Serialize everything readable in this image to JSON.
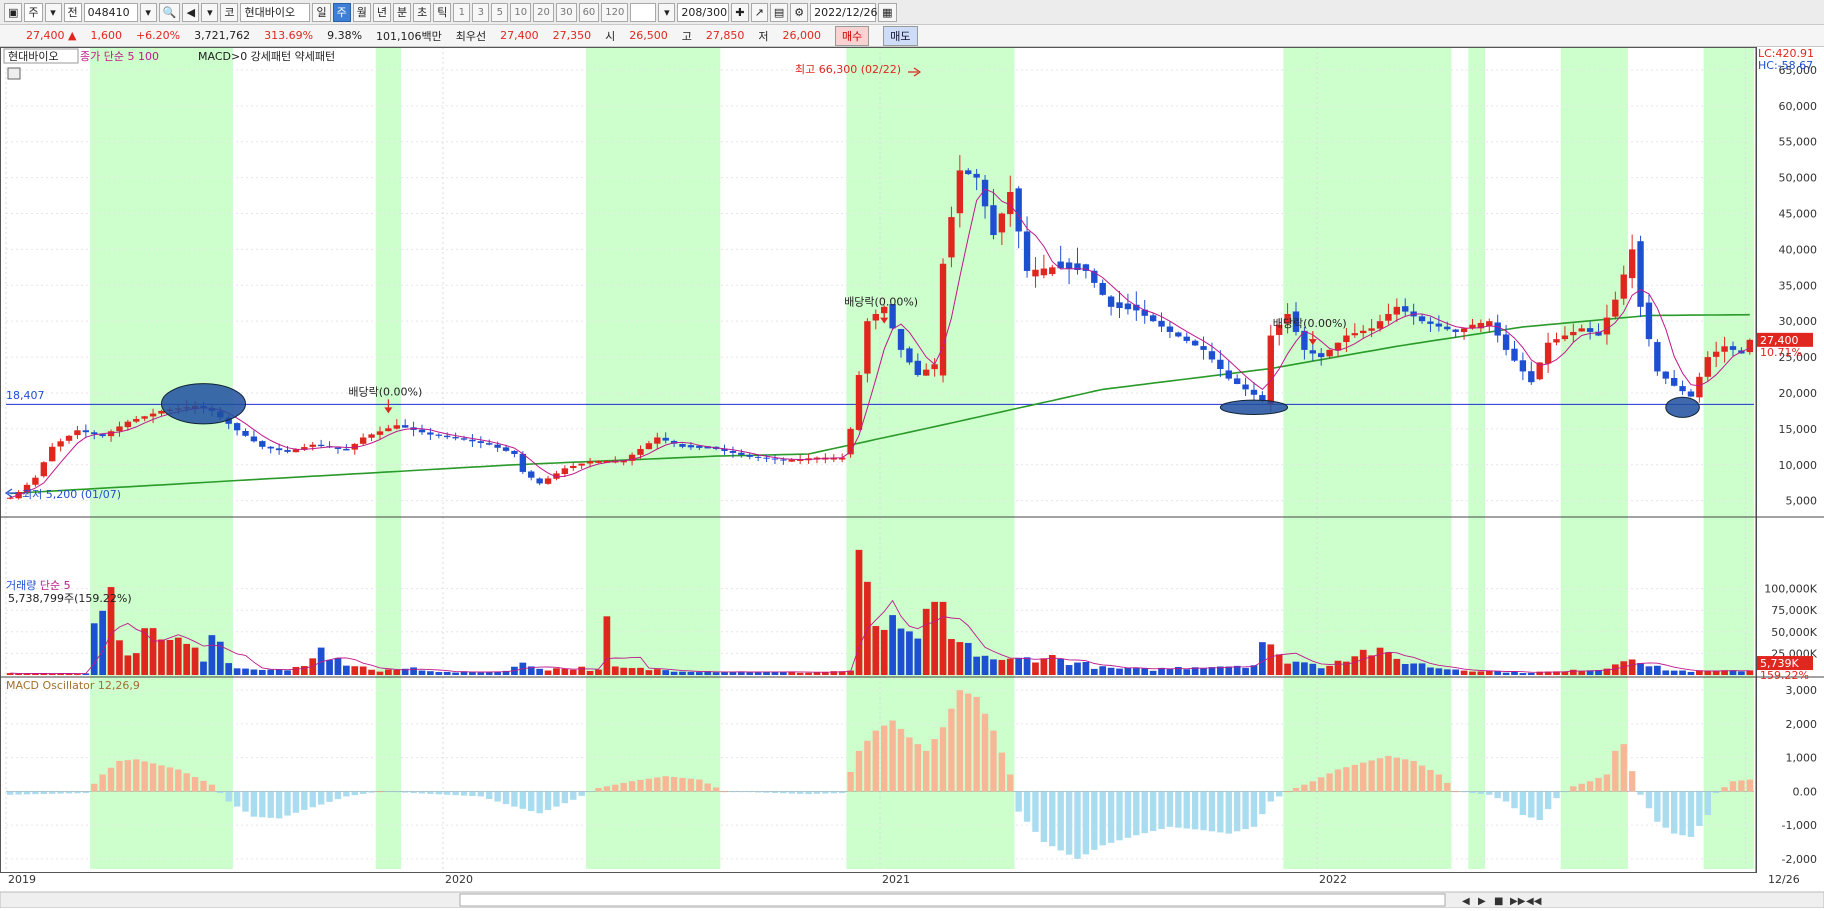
{
  "toolbar": {
    "type_label": "주",
    "market_label": "전",
    "code": "048410",
    "market2": "코",
    "name": "현대바이오",
    "periods": [
      "일",
      "주",
      "월",
      "년"
    ],
    "active_period": "주",
    "min_labels": [
      "분",
      "초",
      "틱"
    ],
    "numbers": [
      "1",
      "3",
      "5",
      "10",
      "20",
      "30",
      "60",
      "120"
    ],
    "count": "208/300",
    "date": "2022/12/26"
  },
  "quote": {
    "price": "27,400",
    "arrow": "▲",
    "change": "1,600",
    "change_pct": "+6.20%",
    "volume": "3,721,762",
    "volume_pct": "313.69%",
    "turnover": "9.38%",
    "market_cap": "101,106백만",
    "best_label": "최우선",
    "ask": "27,400",
    "bid": "27,350",
    "open_label": "시",
    "open": "26,500",
    "high_label": "고",
    "high": "27,850",
    "low_label": "저",
    "low": "26,000",
    "buy_label": "매수",
    "sell_label": "매도"
  },
  "price_panel": {
    "legend_name": "현대바이오",
    "legend_ma": "종가 단순 5 100",
    "legend_pattern": "MACD>0 강세패턴 약세패턴",
    "lc": "LC:420.91",
    "hc": "HC:-58.67",
    "ref_line_value": "18,407",
    "current_price": "27,400",
    "current_pct": "10.71%",
    "high_annotation": "최고 66,300 (02/22)",
    "low_annotation": "최저 5,200 (01/07)",
    "dividend_label": "배당락(0.00%)"
  },
  "volume_panel": {
    "legend": "거래량",
    "legend_ma": "단순 5",
    "value_text": "5,738,799주(159.22%)",
    "current": "5,739K",
    "current_pct": "159.22%"
  },
  "macd_panel": {
    "legend": "MACD Oscillator 12,26,9"
  },
  "colors": {
    "up": "#e0271f",
    "down": "#1f4fd1",
    "ma5": "#c0188c",
    "ma100": "#2a9a2a",
    "band": "#ccffcc",
    "macd_pos": "#f7b797",
    "macd_neg": "#a9dcef"
  },
  "chart_data": {
    "type": "candlestick",
    "price_axis": {
      "ticks": [
        "65,000",
        "60,000",
        "55,000",
        "50,000",
        "45,000",
        "40,000",
        "35,000",
        "30,000",
        "25,000",
        "20,000",
        "15,000",
        "10,000",
        "5,000"
      ],
      "range": [
        3000,
        67500
      ]
    },
    "volume_axis": {
      "ticks": [
        "100,000K",
        "75,000K",
        "50,000K",
        "25,000K"
      ],
      "range": [
        0,
        125000
      ]
    },
    "macd_axis": {
      "ticks": [
        "3,000",
        "2,000",
        "1,000",
        "0.00",
        "-1,000",
        "-2,000"
      ],
      "range": [
        -2300,
        3300
      ]
    },
    "x_labels": [
      {
        "label": "2019",
        "week": 0
      },
      {
        "label": "2020",
        "week": 52
      },
      {
        "label": "2021",
        "week": 104
      },
      {
        "label": "2022",
        "week": 156
      },
      {
        "label": "12/26",
        "week": 207
      }
    ],
    "weeks": 208,
    "highlight_bands": [
      [
        10,
        26
      ],
      [
        44,
        46
      ],
      [
        69,
        84
      ],
      [
        100,
        119
      ],
      [
        152,
        171
      ],
      [
        174,
        175
      ],
      [
        185,
        192
      ],
      [
        202,
        207
      ]
    ],
    "ref_price": 18407,
    "price_key_points": [
      [
        0,
        5400
      ],
      [
        1,
        6200
      ],
      [
        2,
        7200
      ],
      [
        3,
        8200
      ],
      [
        5,
        12500
      ],
      [
        8,
        14800
      ],
      [
        11,
        14000
      ],
      [
        14,
        16000
      ],
      [
        18,
        17500
      ],
      [
        22,
        18200
      ],
      [
        24,
        17500
      ],
      [
        27,
        14800
      ],
      [
        30,
        12500
      ],
      [
        33,
        11800
      ],
      [
        36,
        12800
      ],
      [
        40,
        12000
      ],
      [
        42,
        13800
      ],
      [
        46,
        15500
      ],
      [
        50,
        14200
      ],
      [
        54,
        13500
      ],
      [
        57,
        12800
      ],
      [
        60,
        11500
      ],
      [
        61,
        9000
      ],
      [
        63,
        7400
      ],
      [
        66,
        9500
      ],
      [
        69,
        10500
      ],
      [
        73,
        10600
      ],
      [
        77,
        13800
      ],
      [
        80,
        12500
      ],
      [
        84,
        12200
      ],
      [
        88,
        11100
      ],
      [
        92,
        10600
      ],
      [
        96,
        11000
      ],
      [
        99,
        11000
      ],
      [
        100,
        15000
      ],
      [
        102,
        30000
      ],
      [
        104,
        32000
      ],
      [
        106,
        26000
      ],
      [
        108,
        22500
      ],
      [
        110,
        24000
      ],
      [
        111,
        38000
      ],
      [
        113,
        51000
      ],
      [
        115,
        50000
      ],
      [
        117,
        42000
      ],
      [
        119,
        48000
      ],
      [
        121,
        37000
      ],
      [
        124,
        37500
      ],
      [
        128,
        37000
      ],
      [
        131,
        32000
      ],
      [
        134,
        31500
      ],
      [
        138,
        28500
      ],
      [
        142,
        26000
      ],
      [
        145,
        22000
      ],
      [
        147,
        20500
      ],
      [
        149,
        19000
      ],
      [
        150,
        28000
      ],
      [
        152,
        31000
      ],
      [
        154,
        26000
      ],
      [
        156,
        25000
      ],
      [
        159,
        28000
      ],
      [
        162,
        29000
      ],
      [
        165,
        32000
      ],
      [
        168,
        30000
      ],
      [
        172,
        28500
      ],
      [
        174,
        29500
      ],
      [
        176,
        30000
      ],
      [
        178,
        26000
      ],
      [
        181,
        21500
      ],
      [
        183,
        27000
      ],
      [
        187,
        29000
      ],
      [
        189,
        28000
      ],
      [
        191,
        33000
      ],
      [
        193,
        40000
      ],
      [
        194,
        32000
      ],
      [
        196,
        23000
      ],
      [
        198,
        21000
      ],
      [
        200,
        19500
      ],
      [
        202,
        25000
      ],
      [
        204,
        26500
      ],
      [
        206,
        25500
      ],
      [
        207,
        27400
      ]
    ],
    "ma100_key_points": [
      [
        0,
        6000
      ],
      [
        60,
        10000
      ],
      [
        84,
        11200
      ],
      [
        95,
        11500
      ],
      [
        110,
        15300
      ],
      [
        130,
        20500
      ],
      [
        150,
        23400
      ],
      [
        165,
        26500
      ],
      [
        180,
        29200
      ],
      [
        195,
        30800
      ],
      [
        207,
        30900
      ]
    ],
    "volume_key_points": [
      [
        0,
        2000
      ],
      [
        9,
        1500
      ],
      [
        10,
        48000
      ],
      [
        12,
        80000
      ],
      [
        14,
        28000
      ],
      [
        16,
        42000
      ],
      [
        17,
        55000
      ],
      [
        19,
        40000
      ],
      [
        21,
        32000
      ],
      [
        23,
        22000
      ],
      [
        24,
        60000
      ],
      [
        26,
        12000
      ],
      [
        30,
        5000
      ],
      [
        35,
        8000
      ],
      [
        37,
        28000
      ],
      [
        39,
        16000
      ],
      [
        44,
        4000
      ],
      [
        48,
        8000
      ],
      [
        52,
        3000
      ],
      [
        58,
        4000
      ],
      [
        61,
        12000
      ],
      [
        64,
        7000
      ],
      [
        68,
        8000
      ],
      [
        70,
        5000
      ],
      [
        71,
        60000
      ],
      [
        72,
        8000
      ],
      [
        80,
        5000
      ],
      [
        85,
        4000
      ],
      [
        95,
        3000
      ],
      [
        100,
        5000
      ],
      [
        101,
        118000
      ],
      [
        103,
        60000
      ],
      [
        105,
        54000
      ],
      [
        107,
        40000
      ],
      [
        109,
        60000
      ],
      [
        111,
        75000
      ],
      [
        112,
        40000
      ],
      [
        114,
        30000
      ],
      [
        118,
        15000
      ],
      [
        123,
        22000
      ],
      [
        126,
        16000
      ],
      [
        130,
        8000
      ],
      [
        135,
        6000
      ],
      [
        142,
        10000
      ],
      [
        148,
        12000
      ],
      [
        149,
        40000
      ],
      [
        151,
        20000
      ],
      [
        156,
        10000
      ],
      [
        160,
        25000
      ],
      [
        162,
        28000
      ],
      [
        165,
        18000
      ],
      [
        170,
        8000
      ],
      [
        175,
        5000
      ],
      [
        180,
        3000
      ],
      [
        185,
        4000
      ],
      [
        190,
        8000
      ],
      [
        193,
        25000
      ],
      [
        195,
        10000
      ],
      [
        198,
        5000
      ],
      [
        203,
        4000
      ],
      [
        207,
        5700
      ]
    ],
    "macd_key_points": [
      [
        0,
        -100
      ],
      [
        9,
        -50
      ],
      [
        11,
        500
      ],
      [
        13,
        900
      ],
      [
        15,
        950
      ],
      [
        20,
        650
      ],
      [
        24,
        200
      ],
      [
        26,
        -300
      ],
      [
        29,
        -750
      ],
      [
        32,
        -800
      ],
      [
        35,
        -550
      ],
      [
        40,
        -150
      ],
      [
        44,
        0
      ],
      [
        48,
        -50
      ],
      [
        56,
        -150
      ],
      [
        60,
        -450
      ],
      [
        63,
        -650
      ],
      [
        67,
        -250
      ],
      [
        70,
        100
      ],
      [
        74,
        300
      ],
      [
        78,
        450
      ],
      [
        82,
        350
      ],
      [
        85,
        0
      ],
      [
        95,
        -80
      ],
      [
        99,
        -50
      ],
      [
        101,
        1200
      ],
      [
        103,
        1800
      ],
      [
        105,
        2100
      ],
      [
        107,
        1600
      ],
      [
        109,
        1200
      ],
      [
        111,
        1900
      ],
      [
        113,
        3000
      ],
      [
        115,
        2800
      ],
      [
        117,
        1800
      ],
      [
        119,
        500
      ],
      [
        120,
        -600
      ],
      [
        123,
        -1500
      ],
      [
        127,
        -2000
      ],
      [
        130,
        -1600
      ],
      [
        134,
        -1300
      ],
      [
        138,
        -1050
      ],
      [
        142,
        -1150
      ],
      [
        145,
        -1250
      ],
      [
        148,
        -1050
      ],
      [
        150,
        -300
      ],
      [
        152,
        0
      ],
      [
        155,
        300
      ],
      [
        158,
        650
      ],
      [
        161,
        850
      ],
      [
        164,
        1050
      ],
      [
        167,
        900
      ],
      [
        170,
        500
      ],
      [
        172,
        0
      ],
      [
        176,
        -100
      ],
      [
        178,
        -300
      ],
      [
        180,
        -700
      ],
      [
        182,
        -850
      ],
      [
        184,
        -200
      ],
      [
        186,
        150
      ],
      [
        188,
        300
      ],
      [
        190,
        500
      ],
      [
        191,
        1200
      ],
      [
        192,
        1400
      ],
      [
        193,
        600
      ],
      [
        194,
        -100
      ],
      [
        196,
        -900
      ],
      [
        198,
        -1250
      ],
      [
        200,
        -1350
      ],
      [
        202,
        -700
      ],
      [
        203,
        -50
      ],
      [
        205,
        300
      ],
      [
        207,
        350
      ]
    ],
    "annotations": [
      {
        "type": "dividend",
        "week": 45,
        "price": 18000
      },
      {
        "type": "dividend",
        "week": 104,
        "price": 30500
      },
      {
        "type": "dividend",
        "week": 155,
        "price": 27500
      }
    ],
    "ellipses": [
      {
        "week": 23,
        "price": 18500,
        "rw": 5,
        "rh": 2800
      },
      {
        "week": 148,
        "price": 18000,
        "rw": 4,
        "rh": 1000
      },
      {
        "week": 199,
        "price": 18000,
        "rw": 2,
        "rh": 1400
      }
    ]
  }
}
